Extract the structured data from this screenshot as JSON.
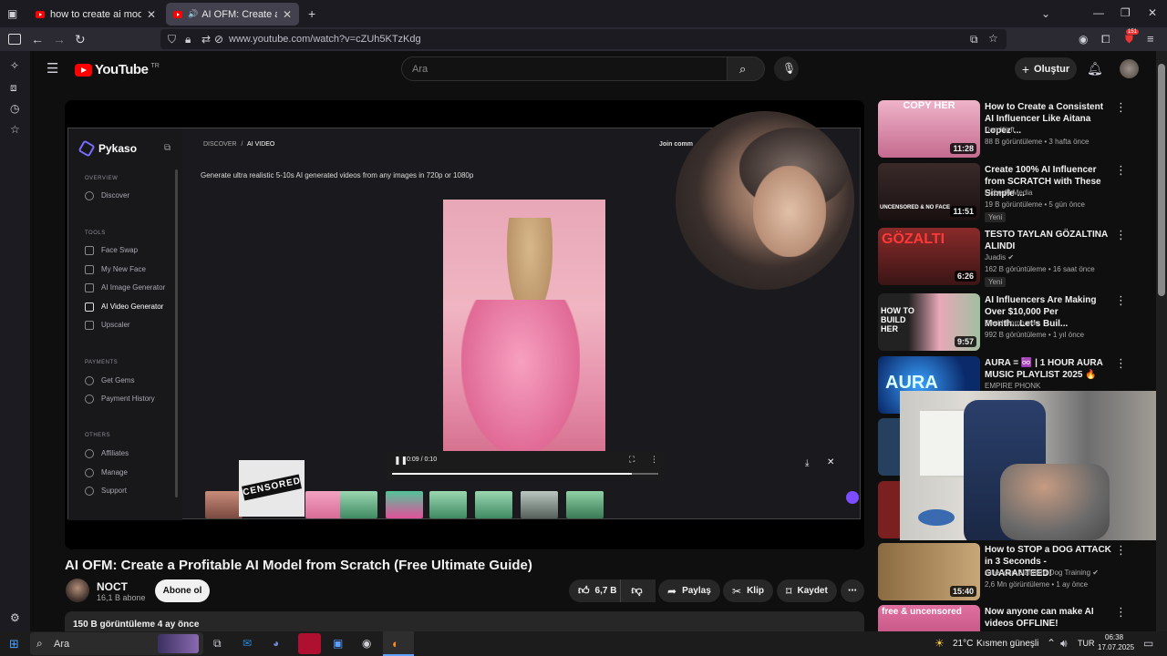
{
  "browser": {
    "tabs": [
      {
        "label": "how to create ai models for onl",
        "active": false
      },
      {
        "label": "AI OFM: Create a Profitable",
        "active": true
      }
    ],
    "url": "www.youtube.com/watch?v=cZUh5KTzKdg",
    "notification_badge": "151"
  },
  "youtube": {
    "logo_text": "YouTube",
    "country": "TR",
    "search_placeholder": "Ara",
    "create_label": "Oluştur"
  },
  "player": {
    "pykaso": {
      "brand": "Pykaso",
      "breadcrumb_1": "DISCOVER",
      "breadcrumb_sep": "/",
      "breadcrumb_2": "AI VIDEO",
      "join": "Join comm",
      "headline": "Generate ultra realistic 5-10s AI generated videos from any images in 720p or 1080p",
      "sections": {
        "overview": "OVERVIEW",
        "tools": "TOOLS",
        "payments": "PAYMENTS",
        "others": "OTHERS"
      },
      "items": {
        "discover": "Discover",
        "face_swap": "Face Swap",
        "my_new_face": "My New Face",
        "ai_image": "AI Image Generator",
        "ai_video": "AI Video Generator",
        "upscaler": "Upscaler",
        "get_gems": "Get Gems",
        "payment_history": "Payment History",
        "affiliates": "Affiliates",
        "manage": "Manage",
        "support": "Support"
      },
      "video_time": "0:09 / 0:10",
      "video_progress": 0.9
    },
    "censor_text": "CENSORED"
  },
  "video": {
    "title": "AI OFM: Create a Profitable AI Model from Scratch (Free Ultimate Guide)",
    "channel": "NOCT",
    "subscribers": "16,1 B abone",
    "subscribe_label": "Abone ol",
    "likes": "6,7 B",
    "share_label": "Paylaş",
    "clip_label": "Klip",
    "save_label": "Kaydet",
    "views_age": "150 B görüntüleme  4 ay önce"
  },
  "recommendations": [
    {
      "title": "How to Create a Consistent AI Influencer Like Aitana Lopez ...",
      "channel": "Dan Kieft",
      "meta": "88 B görüntüleme • 3 hafta önce",
      "duration": "11:28",
      "thumb_text": "COPY HER",
      "badge": ""
    },
    {
      "title": "Create 100% AI Influencer from SCRATCH with These Simple ...",
      "channel": "Licbe AI Media",
      "meta": "19 B görüntüleme • 5 gün önce",
      "duration": "11:51",
      "thumb_text": "UNCENSORED & NO FACE",
      "badge": "Yeni"
    },
    {
      "title": "TESTO TAYLAN GÖZALTINA ALINDI",
      "channel": "Juadis",
      "meta": "162 B görüntüleme • 16 saat önce",
      "duration": "6:26",
      "thumb_text": "GÖZALTI",
      "badge": "Yeni"
    },
    {
      "title": "AI Influencers Are Making Over $10,000 Per Month...Let's Buil...",
      "channel": "David Bombardo",
      "meta": "992 B görüntüleme • 1 yıl önce",
      "duration": "9:57",
      "thumb_text": "HOW TO BUILD HER",
      "badge": ""
    },
    {
      "title": "AURA = ♾️ | 1 HOUR AURA MUSIC PLAYLIST 2025 🔥",
      "channel": "EMPIRE PHONK",
      "meta": "",
      "duration": "",
      "thumb_text": "AURA",
      "badge": ""
    },
    {
      "title": "How to STOP a DOG ATTACK in 3 Seconds - GUARANTEED!",
      "channel": "American Standard Dog Training",
      "meta": "2,6 Mn görüntüleme • 1 ay önce",
      "duration": "15:40",
      "thumb_text": "",
      "badge": ""
    },
    {
      "title": "Now anyone can make AI videos OFFLINE!",
      "channel": "",
      "meta": "",
      "duration": "",
      "thumb_text": "free & uncensored",
      "badge": ""
    }
  ],
  "taskbar": {
    "search": "Ara",
    "weather": "21°C",
    "weather_desc": "Kısmen güneşli",
    "lang": "TUR",
    "time": "06:38",
    "date": "17.07.2025"
  },
  "colors": {
    "yt_red": "#ff0000",
    "background": "#0f0f0f",
    "pill": "#272727"
  }
}
